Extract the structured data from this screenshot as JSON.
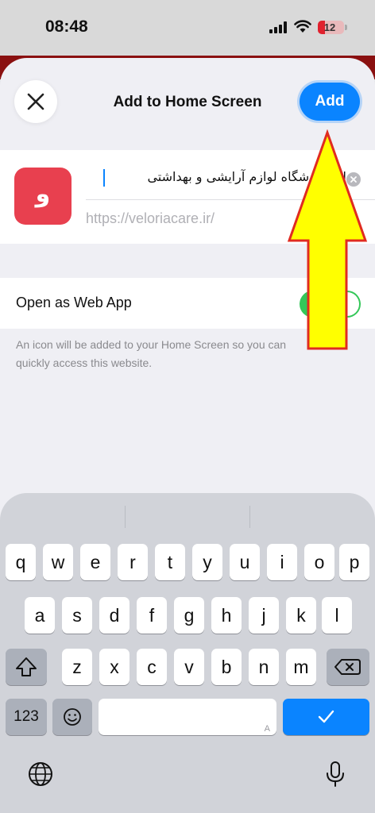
{
  "status_bar": {
    "time": "08:48",
    "battery_level": "12",
    "colors": {
      "battery_fill": "#e0212e"
    }
  },
  "sheet": {
    "title": "Add to Home Screen",
    "close_icon": "close-icon",
    "add_label": "Add"
  },
  "site": {
    "icon_glyph": "و",
    "icon_color": "#e8404f",
    "name_value": "ا – فروشگاه لوازم آرایشی و بهداشتی",
    "url": "https://veloriacare.ir/"
  },
  "web_app": {
    "label": "Open as Web App",
    "enabled": true,
    "footnote": "An icon will be added to your Home Screen so you can quickly access this website."
  },
  "keyboard": {
    "row1": [
      "q",
      "w",
      "e",
      "r",
      "t",
      "y",
      "u",
      "i",
      "o",
      "p"
    ],
    "row2": [
      "a",
      "s",
      "d",
      "f",
      "g",
      "h",
      "j",
      "k",
      "l"
    ],
    "row3": [
      "z",
      "x",
      "c",
      "v",
      "b",
      "n",
      "m"
    ],
    "numbers_label": "123",
    "emoji_icon": "emoji-icon",
    "shift_icon": "shift-icon",
    "delete_icon": "backspace-icon",
    "return_icon": "checkmark-icon",
    "space_hint": "A",
    "globe_icon": "globe-icon",
    "mic_icon": "microphone-icon"
  },
  "annotation": {
    "type": "yellow-arrow",
    "points_to": "Add"
  }
}
